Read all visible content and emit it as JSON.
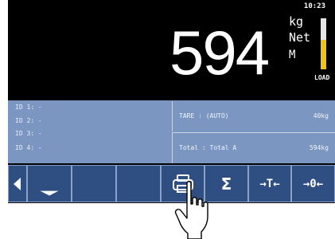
{
  "display": {
    "clock": "10:23",
    "weight": "594",
    "unit": "kg",
    "mode": "Net",
    "stability": "M",
    "load_label": "LOAD",
    "load_fraction": 0.58
  },
  "ids": [
    "ID 1: -",
    "ID 2: -",
    "ID 3: -",
    "ID 4: -"
  ],
  "tare": {
    "label": "TARE  : (AUTO)",
    "value": "40kg"
  },
  "total": {
    "label": "Total : Total A",
    "value": "594kg"
  },
  "toolbar": {
    "keys": [
      {
        "name": "prev-page-key",
        "icon": "left-arrow-icon",
        "label": ""
      },
      {
        "name": "page-indicator-key",
        "icon": "underscore-line-icon",
        "label": ""
      },
      {
        "name": "empty-key-1",
        "label": ""
      },
      {
        "name": "empty-key-2",
        "label": ""
      },
      {
        "name": "print-key",
        "icon": "printer-icon",
        "label": ""
      },
      {
        "name": "sum-key",
        "label": "Σ"
      },
      {
        "name": "tare-key",
        "label": "→T←"
      },
      {
        "name": "zero-key",
        "label": "→0←"
      }
    ]
  },
  "colors": {
    "screen": "#000000",
    "panel": "#7a96c1",
    "key": "#2f4f82",
    "load_fill": "#f0c417"
  }
}
